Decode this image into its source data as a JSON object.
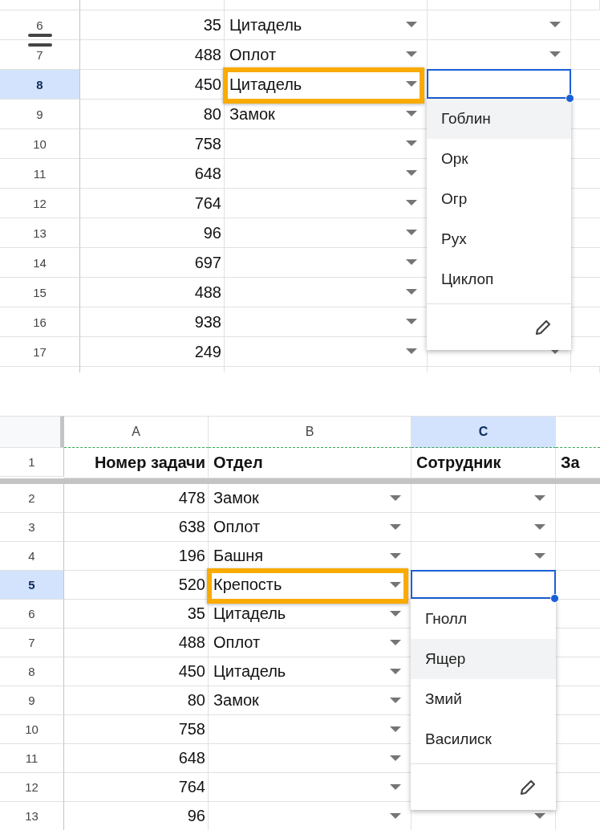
{
  "panels": [
    {
      "rows": [
        {
          "kind": "data",
          "number": "6",
          "cells": [
            "35",
            "Цитадель",
            ""
          ],
          "selected": false,
          "resize_handle": true
        },
        {
          "kind": "data",
          "number": "7",
          "cells": [
            "488",
            "Оплот",
            ""
          ],
          "selected": false
        },
        {
          "kind": "data",
          "number": "8",
          "cells": [
            "450",
            "Цитадель",
            ""
          ],
          "selected": true,
          "highlight_box": true,
          "dropdown": {
            "options": [
              {
                "label": "Гоблин",
                "highlighted": true
              },
              {
                "label": "Орк",
                "highlighted": false
              },
              {
                "label": "Огр",
                "highlighted": false
              },
              {
                "label": "Рух",
                "highlighted": false
              },
              {
                "label": "Циклоп",
                "highlighted": false
              }
            ]
          }
        },
        {
          "kind": "data",
          "number": "9",
          "cells": [
            "80",
            "Замок",
            ""
          ],
          "selected": false
        },
        {
          "kind": "data",
          "number": "10",
          "cells": [
            "758",
            "",
            ""
          ],
          "selected": false
        },
        {
          "kind": "data",
          "number": "11",
          "cells": [
            "648",
            "",
            ""
          ],
          "selected": false
        },
        {
          "kind": "data",
          "number": "12",
          "cells": [
            "764",
            "",
            ""
          ],
          "selected": false
        },
        {
          "kind": "data",
          "number": "13",
          "cells": [
            "96",
            "",
            ""
          ],
          "selected": false
        },
        {
          "kind": "data",
          "number": "14",
          "cells": [
            "697",
            "",
            ""
          ],
          "selected": false
        },
        {
          "kind": "data",
          "number": "15",
          "cells": [
            "488",
            "",
            ""
          ],
          "selected": false
        },
        {
          "kind": "data",
          "number": "16",
          "cells": [
            "938",
            "",
            ""
          ],
          "selected": false
        },
        {
          "kind": "data",
          "number": "17",
          "cells": [
            "249",
            "",
            ""
          ],
          "selected": false
        }
      ]
    },
    {
      "column_headers": [
        {
          "label": "A",
          "selected": false
        },
        {
          "label": "B",
          "selected": false
        },
        {
          "label": "C",
          "selected": true
        }
      ],
      "rows": [
        {
          "kind": "header",
          "number": "1",
          "cells": [
            "Номер задачи",
            "Отдел",
            "Сотрудник",
            "За"
          ],
          "selected": false,
          "frozen": true
        },
        {
          "kind": "data",
          "number": "2",
          "cells": [
            "478",
            "Замок",
            ""
          ],
          "selected": false
        },
        {
          "kind": "data",
          "number": "3",
          "cells": [
            "638",
            "Оплот",
            ""
          ],
          "selected": false
        },
        {
          "kind": "data",
          "number": "4",
          "cells": [
            "196",
            "Башня",
            ""
          ],
          "selected": false
        },
        {
          "kind": "data",
          "number": "5",
          "cells": [
            "520",
            "Крепость",
            ""
          ],
          "selected": true,
          "highlight_box": true,
          "dropdown": {
            "options": [
              {
                "label": "Гнолл",
                "highlighted": false
              },
              {
                "label": "Ящер",
                "highlighted": true
              },
              {
                "label": "Змий",
                "highlighted": false
              },
              {
                "label": "Василиск",
                "highlighted": false
              }
            ]
          }
        },
        {
          "kind": "data",
          "number": "6",
          "cells": [
            "35",
            "Цитадель",
            ""
          ],
          "selected": false
        },
        {
          "kind": "data",
          "number": "7",
          "cells": [
            "488",
            "Оплот",
            ""
          ],
          "selected": false
        },
        {
          "kind": "data",
          "number": "8",
          "cells": [
            "450",
            "Цитадель",
            ""
          ],
          "selected": false
        },
        {
          "kind": "data",
          "number": "9",
          "cells": [
            "80",
            "Замок",
            ""
          ],
          "selected": false
        },
        {
          "kind": "data",
          "number": "10",
          "cells": [
            "758",
            "",
            ""
          ],
          "selected": false
        },
        {
          "kind": "data",
          "number": "11",
          "cells": [
            "648",
            "",
            ""
          ],
          "selected": false
        },
        {
          "kind": "data",
          "number": "12",
          "cells": [
            "764",
            "",
            ""
          ],
          "selected": false
        },
        {
          "kind": "data",
          "number": "13",
          "cells": [
            "96",
            "",
            ""
          ],
          "selected": false
        }
      ]
    }
  ]
}
